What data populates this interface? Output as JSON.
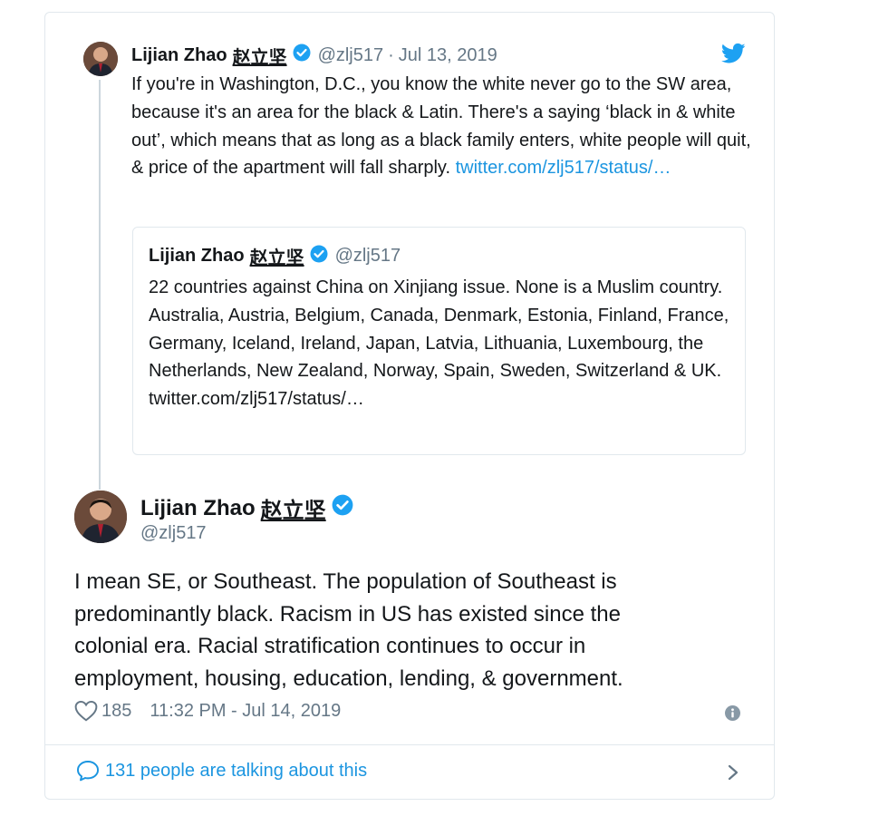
{
  "parent_tweet": {
    "author_name": "Lijian Zhao",
    "author_name_cjk": "赵立坚",
    "handle": "@zlj517",
    "date_sep": "·",
    "date": "Jul 13, 2019",
    "text": "If you're in Washington, D.C., you know the white never go to the SW area, because it's an area for the black & Latin. There's a saying ‘black in & white out’, which means that as long as a black family enters, white people will quit, & price of the apartment will fall sharply.",
    "link": "twitter.com/zlj517/status/…"
  },
  "quoted_tweet": {
    "author_name": "Lijian Zhao",
    "author_name_cjk": "赵立坚",
    "handle": "@zlj517",
    "text": "22 countries against China on Xinjiang issue. None is a Muslim country. Australia, Austria, Belgium, Canada, Denmark, Estonia, Finland, France, Germany, Iceland, Ireland, Japan, Latvia, Lithuania, Luxembourg, the Netherlands, New Zealand, Norway, Spain, Sweden, Switzerland & UK.",
    "link": "twitter.com/zlj517/status/…"
  },
  "main_tweet": {
    "author_name": "Lijian Zhao",
    "author_name_cjk": "赵立坚",
    "handle": "@zlj517",
    "text": "I mean SE, or Southeast. The population of Southeast is predominantly black. Racism in US has existed since the colonial era. Racial stratification continues to occur in employment, housing, education, lending, & government.",
    "likes": "185",
    "timestamp": "11:32 PM - Jul 14, 2019"
  },
  "footer": {
    "talking_text": "131 people are talking about this"
  },
  "colors": {
    "link": "#1b95e0",
    "verified": "#1da1f2",
    "secondary_text": "#657786",
    "border": "#e1e8ed"
  },
  "icons": [
    "twitter-bird-icon",
    "verified-badge-icon",
    "heart-icon",
    "info-icon",
    "speech-bubble-icon",
    "chevron-right-icon"
  ]
}
